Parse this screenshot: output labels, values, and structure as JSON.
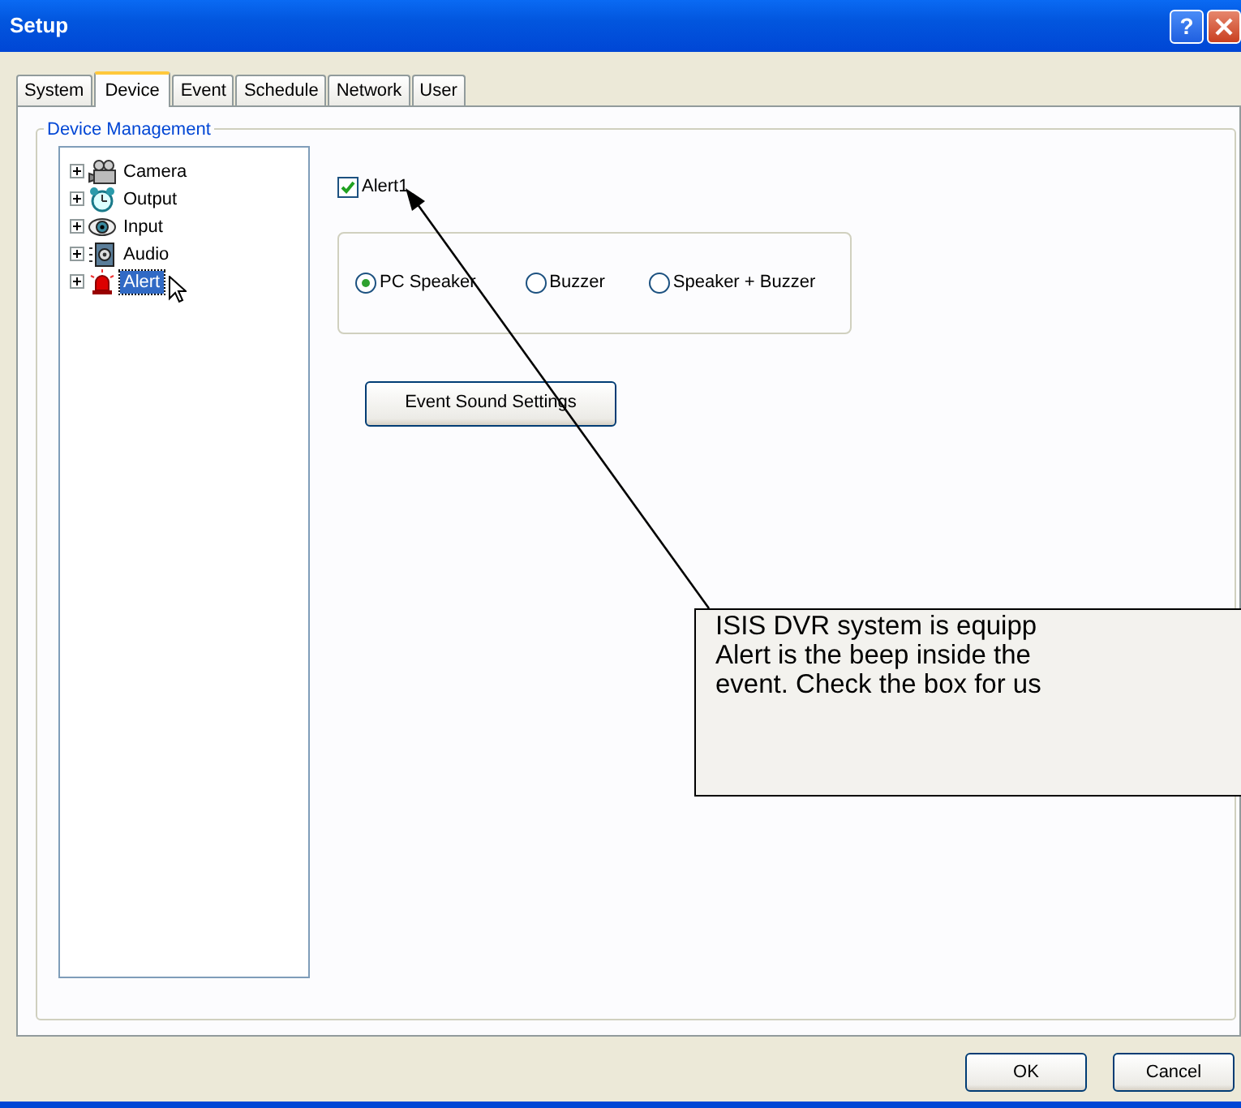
{
  "window": {
    "title": "Setup",
    "help": "?"
  },
  "tabs": [
    {
      "label": "System",
      "selected": false
    },
    {
      "label": "Device",
      "selected": true
    },
    {
      "label": "Event",
      "selected": false
    },
    {
      "label": "Schedule",
      "selected": false
    },
    {
      "label": "Network",
      "selected": false
    },
    {
      "label": "User",
      "selected": false
    }
  ],
  "group": {
    "title": "Device Management"
  },
  "tree": [
    {
      "label": "Camera",
      "kind": "camera",
      "expanded": false,
      "selected": false
    },
    {
      "label": "Output",
      "kind": "clock",
      "expanded": false,
      "selected": false
    },
    {
      "label": "Input",
      "kind": "eye",
      "expanded": false,
      "selected": false
    },
    {
      "label": "Audio",
      "kind": "speaker",
      "expanded": false,
      "selected": false
    },
    {
      "label": "Alert",
      "kind": "siren",
      "expanded": false,
      "selected": true
    }
  ],
  "alert_checkbox": {
    "label": "Alert1",
    "checked": true
  },
  "sound_options": [
    {
      "label": "PC Speaker",
      "selected": true
    },
    {
      "label": "Buzzer",
      "selected": false
    },
    {
      "label": "Speaker + Buzzer",
      "selected": false
    }
  ],
  "event_sound_button": "Event Sound Settings",
  "callout": {
    "lines": [
      "ISIS DVR system is equipp",
      "Alert is the beep inside the",
      "event. Check the box for us"
    ]
  },
  "buttons": [
    "OK",
    "Cancel"
  ]
}
